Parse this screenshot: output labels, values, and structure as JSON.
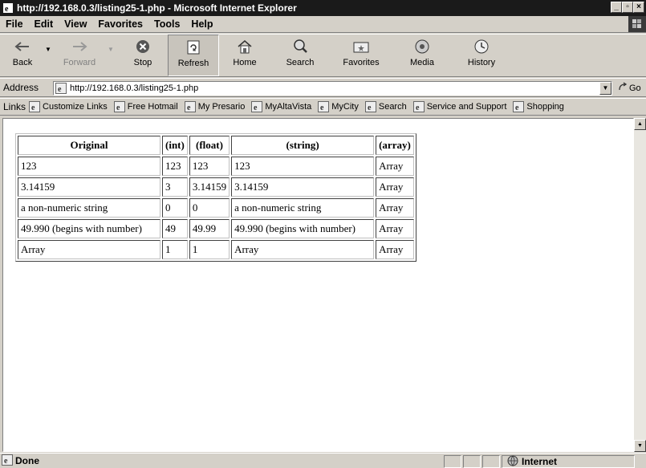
{
  "window": {
    "title": "http://192.168.0.3/listing25-1.php - Microsoft Internet Explorer",
    "buttons": {
      "minimize": "_",
      "maximize": "▫",
      "close": "×"
    }
  },
  "menu": [
    "File",
    "Edit",
    "View",
    "Favorites",
    "Tools",
    "Help"
  ],
  "toolbar": {
    "back": "Back",
    "forward": "Forward",
    "stop": "Stop",
    "refresh": "Refresh",
    "home": "Home",
    "search": "Search",
    "favorites": "Favorites",
    "media": "Media",
    "history": "History"
  },
  "address": {
    "label": "Address",
    "url": "http://192.168.0.3/listing25-1.php",
    "go": "Go"
  },
  "links": {
    "label": "Links",
    "items": [
      "Customize Links",
      "Free Hotmail",
      "My Presario",
      "MyAltaVista",
      "MyCity",
      "Search",
      "Service and Support",
      "Shopping"
    ]
  },
  "table": {
    "headers": [
      "Original",
      "(int)",
      "(float)",
      "(string)",
      "(array)"
    ],
    "rows": [
      [
        "123",
        "123",
        "123",
        "123",
        "Array"
      ],
      [
        "3.14159",
        "3",
        "3.14159",
        "3.14159",
        "Array"
      ],
      [
        "a non-numeric string",
        "0",
        "0",
        "a non-numeric string",
        "Array"
      ],
      [
        "49.990 (begins with number)",
        "49",
        "49.99",
        "49.990 (begins with number)",
        "Array"
      ],
      [
        "Array",
        "1",
        "1",
        "Array",
        "Array"
      ]
    ]
  },
  "status": {
    "text": "Done",
    "zone": "Internet"
  }
}
